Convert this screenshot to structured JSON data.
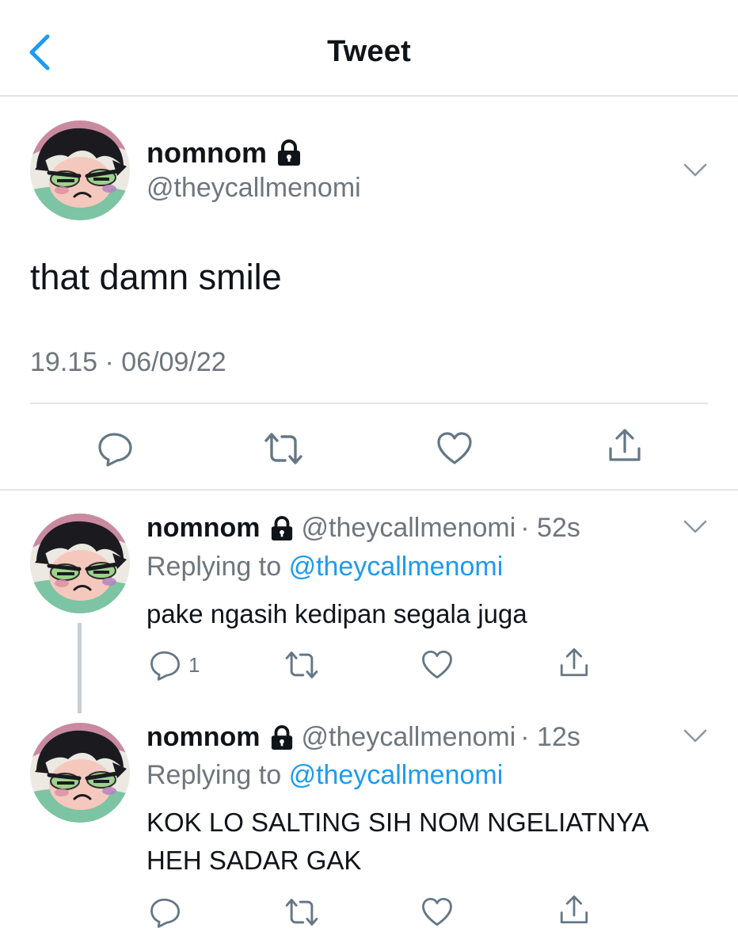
{
  "nav": {
    "title": "Tweet",
    "back_icon": "chevron-left-icon"
  },
  "colors": {
    "accent": "#1d9bf0",
    "text": "#0f1419",
    "secondary": "#6e767d",
    "divider": "#e3e6e8"
  },
  "main_tweet": {
    "display_name": "nomnom",
    "handle": "@theycallmenomi",
    "text": "that damn smile",
    "timestamp": "19.15 · 06/09/22",
    "actions": [
      "reply-icon",
      "retweet-icon",
      "like-icon",
      "share-icon"
    ]
  },
  "replies": [
    {
      "display_name": "nomnom",
      "handle": "@theycallmenomi",
      "age": "· 52s",
      "replying_prefix": "Replying to",
      "replying_to": "@theycallmenomi",
      "text": "pake ngasih kedipan segala juga",
      "reply_count": "1"
    },
    {
      "display_name": "nomnom",
      "handle": "@theycallmenomi",
      "age": "· 12s",
      "replying_prefix": "Replying to",
      "replying_to": "@theycallmenomi",
      "text": "KOK LO SALTING SIH NOM NGELIATNYA HEH SADAR GAK",
      "reply_count": ""
    }
  ]
}
